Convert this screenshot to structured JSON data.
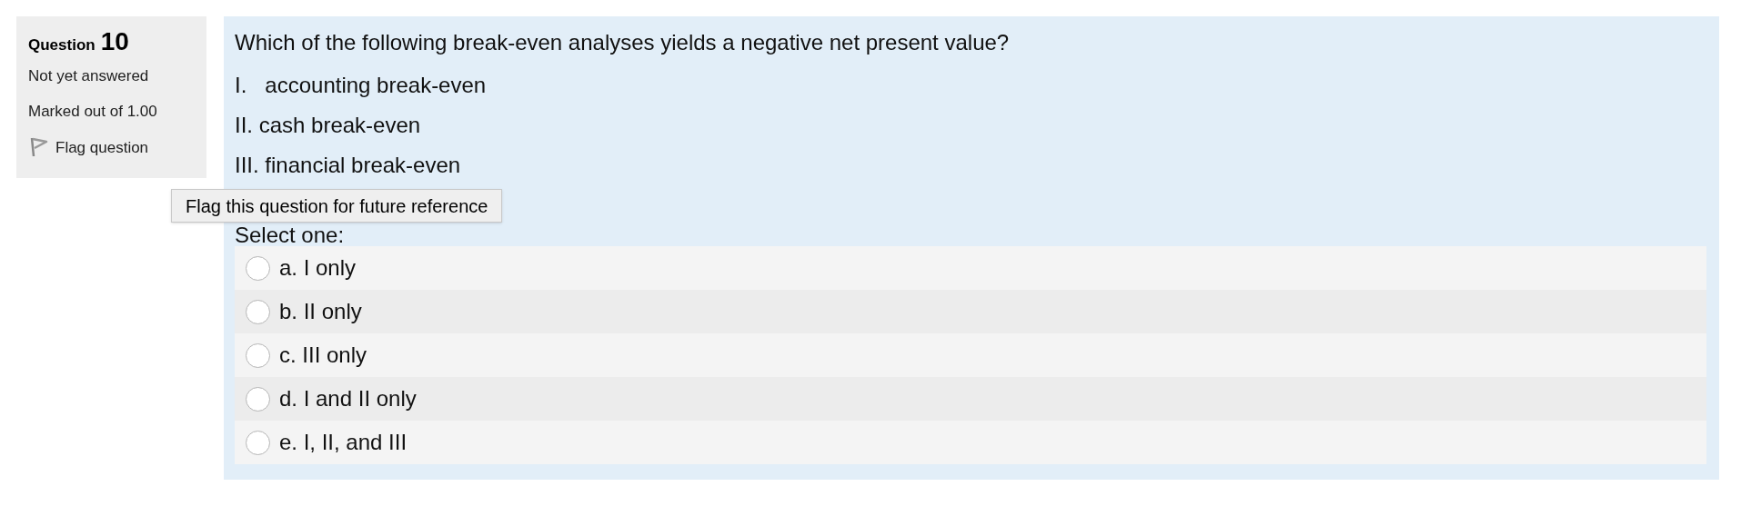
{
  "info": {
    "label": "Question",
    "number": "10",
    "status": "Not yet answered",
    "marks": "Marked out of 1.00",
    "flag": {
      "label": "Flag question",
      "flagged": false
    }
  },
  "tooltip": "Flag this question for future reference",
  "question": {
    "text": "Which of the following break-even analyses yields a negative net present value?",
    "items": [
      "I.   accounting break-even",
      "II. cash break-even",
      "III. financial break-even"
    ],
    "prompt": "Select one:",
    "options": [
      {
        "label": "a. I only",
        "selected": false
      },
      {
        "label": "b. II only",
        "selected": false
      },
      {
        "label": "c. III only",
        "selected": false
      },
      {
        "label": "d. I and II only",
        "selected": false
      },
      {
        "label": "e. I, II, and III",
        "selected": false
      }
    ]
  }
}
